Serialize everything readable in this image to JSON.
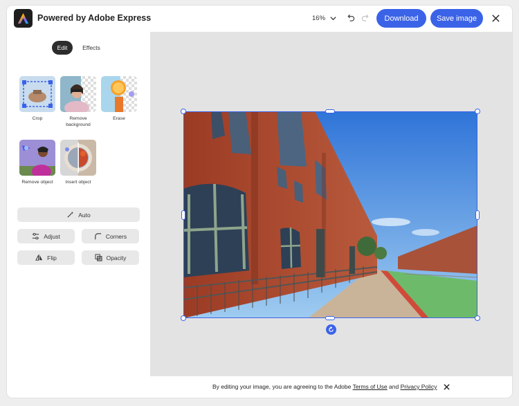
{
  "header": {
    "app_title": "Powered by Adobe Express",
    "zoom": "16%",
    "download_label": "Download",
    "save_label": "Save image"
  },
  "sidebar": {
    "tabs": [
      {
        "label": "Edit",
        "active": true
      },
      {
        "label": "Effects",
        "active": false
      }
    ],
    "tools": [
      {
        "label": "Crop"
      },
      {
        "label": "Remove background"
      },
      {
        "label": "Erase"
      },
      {
        "label": "Remove object"
      },
      {
        "label": "Insert object"
      }
    ],
    "adjust_buttons": {
      "auto": "Auto",
      "adjust": "Adjust",
      "corners": "Corners",
      "flip": "Flip",
      "opacity": "Opacity"
    }
  },
  "footer": {
    "prefix": "By editing your image, you are agreeing to the Adobe ",
    "terms": "Terms of Use",
    "and": " and ",
    "privacy": "Privacy Policy"
  },
  "colors": {
    "accent": "#3b63e8",
    "active_tab": "#2c2c2c"
  }
}
